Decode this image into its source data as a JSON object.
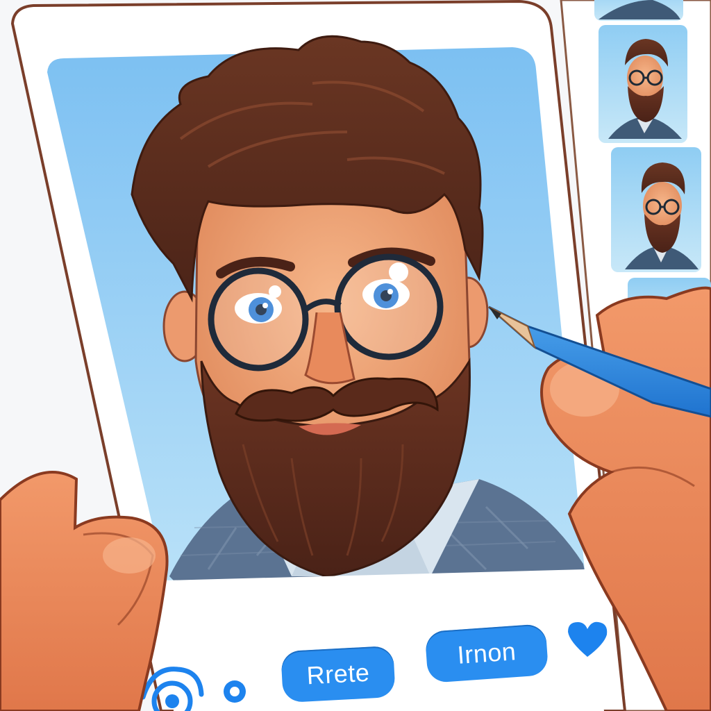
{
  "buttons": {
    "primary_label": "Rrete",
    "secondary_label": "Irnon"
  },
  "icons": {
    "camera": "camera-icon",
    "record": "record-icon",
    "heart": "heart-icon",
    "pencil": "pencil-icon"
  },
  "colors": {
    "accent": "#2a8ef0",
    "photo_bg": "#8ccaf4",
    "hair": "#5a2c1c",
    "skin": "#f0a276"
  }
}
